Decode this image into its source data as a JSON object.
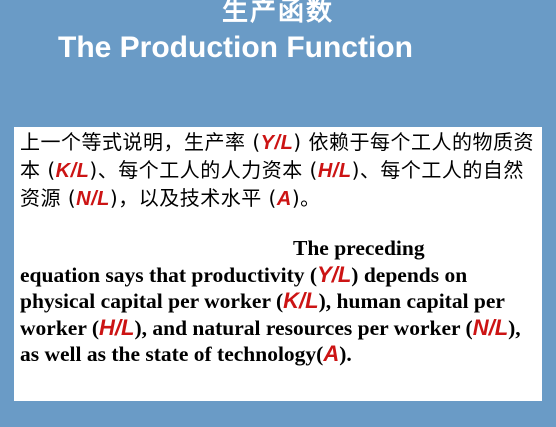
{
  "title": {
    "chinese": "生产函数",
    "english": "The Production Function"
  },
  "colors": {
    "background": "#6a9bc6",
    "title": "#ffffff",
    "box": "#ffffff",
    "text": "#000000",
    "variable": "#cc1414"
  },
  "chinese_paragraph": {
    "t1": "上一个等式说明，生产率 (",
    "v1": "Y/L",
    "t2": ") 依赖于每个工人的物质资本 (",
    "v2": "K/L",
    "t3": ")、每个工人的人力资本 (",
    "v3": "H/L",
    "t4": ")、每个工人的自然资源 (",
    "v4": "N/L",
    "t5": ")，以及技术水平 (",
    "v5": "A",
    "t6": ")。"
  },
  "english_paragraph": {
    "t0": "The preceding",
    "t1": "equation says that productivity (",
    "v1": "Y/L",
    "t2": ") depends on physical capital per worker (",
    "v2": "K/L",
    "t3": "), human capital per worker (",
    "v3": "H/L",
    "t4": "), and natural resources per worker (",
    "v4": "N/L",
    "t5": "), as well as the state of technology(",
    "v5": "A",
    "t6": ")."
  }
}
